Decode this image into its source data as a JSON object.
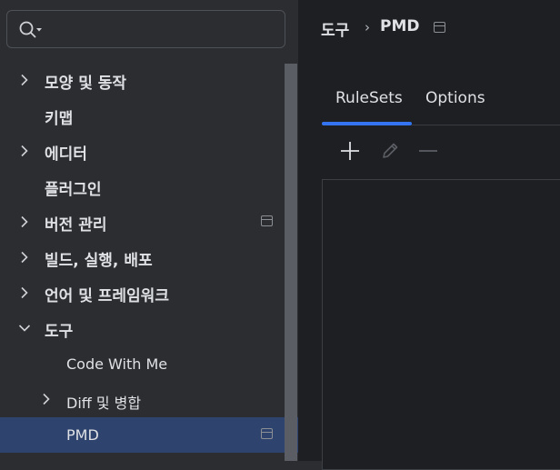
{
  "search": {
    "value": "",
    "placeholder": ""
  },
  "sidebar": {
    "items": [
      {
        "label": "모양 및 동작",
        "expandable": true,
        "expanded": false,
        "project_icon": false
      },
      {
        "label": "키맵",
        "expandable": false,
        "project_icon": false
      },
      {
        "label": "에디터",
        "expandable": true,
        "expanded": false,
        "project_icon": false
      },
      {
        "label": "플러그인",
        "expandable": false,
        "project_icon": false
      },
      {
        "label": "버전 관리",
        "expandable": true,
        "expanded": false,
        "project_icon": true
      },
      {
        "label": "빌드, 실행, 배포",
        "expandable": true,
        "expanded": false,
        "project_icon": false
      },
      {
        "label": "언어 및 프레임워크",
        "expandable": true,
        "expanded": false,
        "project_icon": false
      },
      {
        "label": "도구",
        "expandable": true,
        "expanded": true,
        "project_icon": false
      },
      {
        "label": "Code With Me",
        "expandable": false,
        "project_icon": false
      },
      {
        "label": "Diff 및 병합",
        "expandable": true,
        "expanded": false,
        "project_icon": false
      },
      {
        "label": "PMD",
        "expandable": false,
        "project_icon": true,
        "selected": true
      }
    ]
  },
  "breadcrumb": {
    "parent": "도구",
    "separator": "›",
    "current": "PMD"
  },
  "tabs": [
    {
      "label": "RuleSets",
      "active": true
    },
    {
      "label": "Options",
      "active": false
    }
  ],
  "toolbar": {
    "add_icon": "plus-icon",
    "edit_icon": "pencil-icon",
    "remove_icon": "minus-icon"
  },
  "colors": {
    "sidebar_bg": "#2b2d30",
    "content_bg": "#1e1f22",
    "selection": "#2e436e",
    "accent": "#3574f0",
    "text": "#dfe1e5"
  }
}
